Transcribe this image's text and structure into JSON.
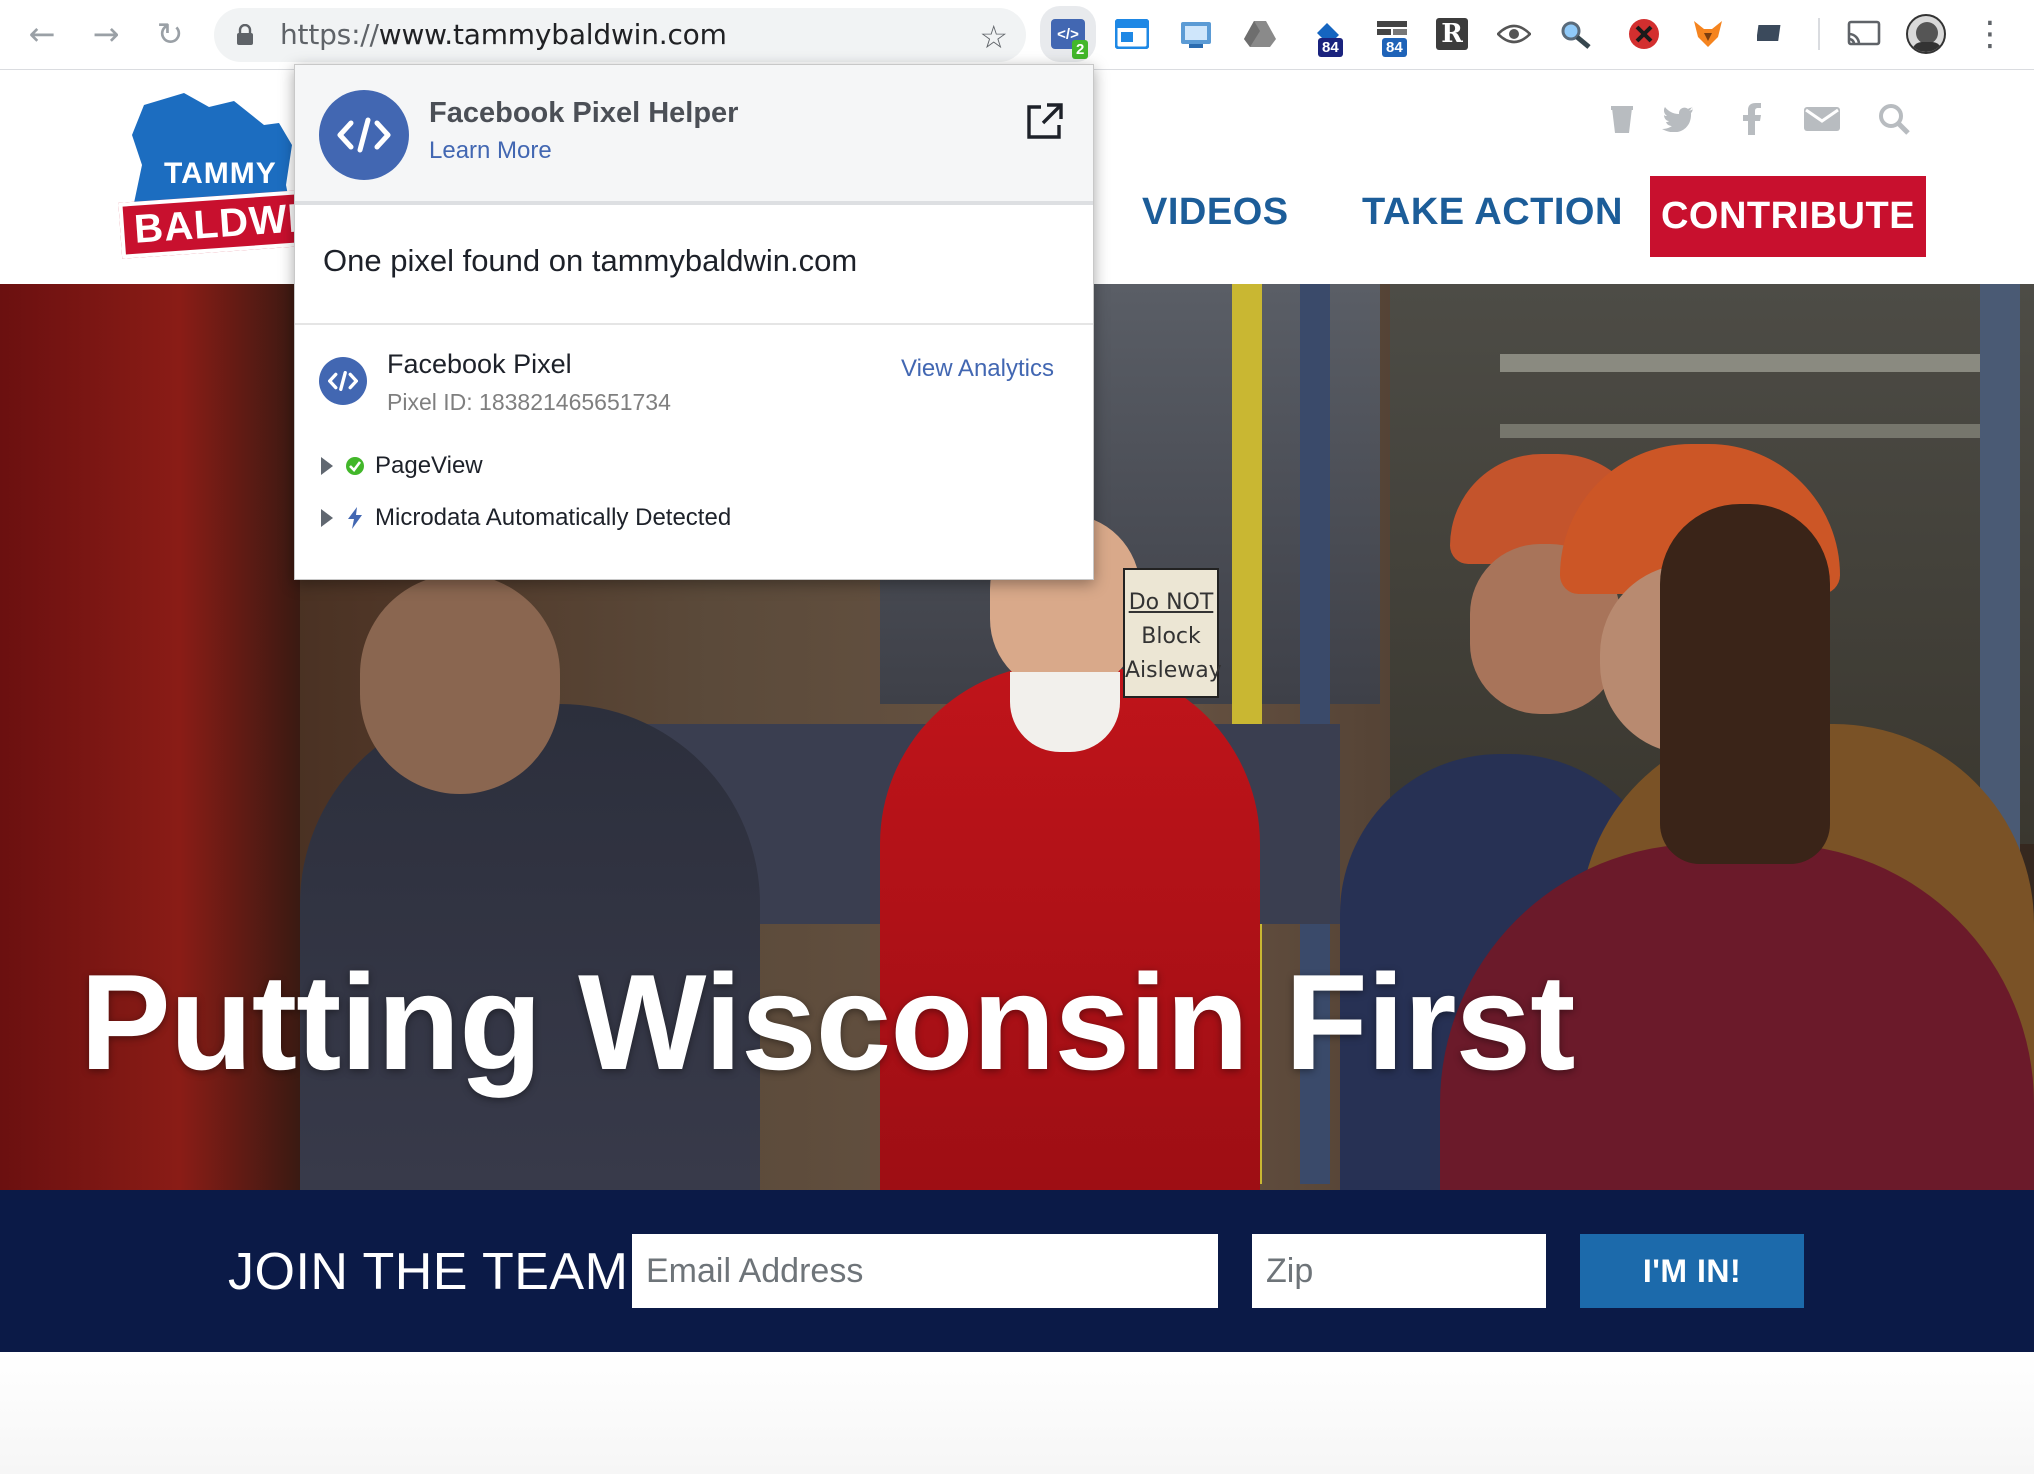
{
  "browser": {
    "url_protocol": "https://",
    "url_host": "www.tammybaldwin.com",
    "extension_badges": {
      "pixel_helper": "2",
      "ext_a": "84",
      "ext_b": "84"
    }
  },
  "site": {
    "logo_top": "TAMMY",
    "logo_bottom": "BALDWIN",
    "nav": {
      "videos": "VIDEOS",
      "take_action": "TAKE ACTION",
      "contribute": "CONTRIBUTE"
    },
    "hero_title": "Putting Wisconsin First",
    "sign_lines": [
      "Do NOT",
      "Block",
      "Aisleway"
    ],
    "join": {
      "title": "JOIN THE TEAM",
      "email_placeholder": "Email Address",
      "zip_placeholder": "Zip",
      "submit": "I'M IN!"
    }
  },
  "popup": {
    "title": "Facebook Pixel Helper",
    "learn_more": "Learn More",
    "found_text": "One pixel found on tammybaldwin.com",
    "pixel_name": "Facebook Pixel",
    "pixel_id": "Pixel ID: 183821465651734",
    "view_analytics": "View Analytics",
    "events": [
      {
        "label": "PageView",
        "status": "success"
      },
      {
        "label": "Microdata Automatically Detected",
        "status": "info"
      }
    ]
  },
  "colors": {
    "brand_blue": "#1c5d99",
    "brand_red": "#c8102e",
    "join_band": "#0b1a47",
    "fb_blue": "#4267b2"
  }
}
